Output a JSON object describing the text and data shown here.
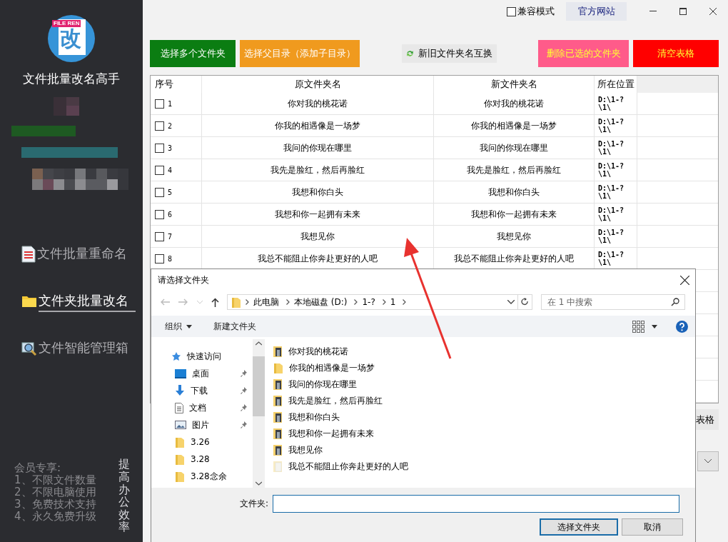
{
  "app": {
    "logo_badge": "FILE REN",
    "logo_char": "改",
    "title": "文件批量改名高手"
  },
  "sidebar": {
    "items": [
      {
        "label": "文件批量重命名",
        "kind": "document",
        "selected": false
      },
      {
        "label": "文件夹批量改名",
        "kind": "folder",
        "selected": true
      },
      {
        "label": "文件智能管理箱",
        "kind": "search",
        "selected": false
      }
    ],
    "promo_lines": [
      "会员专享:",
      "1、不限文件数量",
      "2、不限电脑使用",
      "3、免费技术支持",
      "4、永久免费升级"
    ],
    "slogan": "提高办公效率"
  },
  "titlebar": {
    "compat_mode": {
      "label": "兼容模式",
      "checked": false
    },
    "website": "官方网站"
  },
  "toolbar": [
    {
      "label": "选择多个文件夹",
      "color": "#0b7d12"
    },
    {
      "label": "选择父目录（添加子目录）",
      "color": "#f09a1e"
    },
    {
      "label": "新旧文件夹名互换",
      "color": "#e8e8e8"
    },
    {
      "label": "删除已选的文件夹",
      "color": "#ff5b8a"
    },
    {
      "label": "清空表格",
      "color": "#ff0000"
    }
  ],
  "table": {
    "columns": [
      "序号",
      "原文件夹名",
      "新文件夹名",
      "所在位置"
    ],
    "rows": [
      {
        "checked": false,
        "index": "1",
        "original": "你对我的桃花诺",
        "new": "你对我的桃花诺",
        "location": "D:\\1-?\\1\\"
      },
      {
        "checked": false,
        "index": "2",
        "original": "你我的相遇像是一场梦",
        "new": "你我的相遇像是一场梦",
        "location": "D:\\1-?\\1\\"
      },
      {
        "checked": false,
        "index": "3",
        "original": "我问的你现在哪里",
        "new": "我问的你现在哪里",
        "location": "D:\\1-?\\1\\"
      },
      {
        "checked": false,
        "index": "4",
        "original": "我先是脸红，然后再脸红",
        "new": "我先是脸红，然后再脸红",
        "location": "D:\\1-?\\1\\"
      },
      {
        "checked": false,
        "index": "5",
        "original": "我想和你白头",
        "new": "我想和你白头",
        "location": "D:\\1-?\\1\\"
      },
      {
        "checked": false,
        "index": "6",
        "original": "我想和你一起拥有未来",
        "new": "我想和你一起拥有未来",
        "location": "D:\\1-?\\1\\"
      },
      {
        "checked": false,
        "index": "7",
        "original": "我想见你",
        "new": "我想见你",
        "location": "D:\\1-?\\1\\"
      },
      {
        "checked": false,
        "index": "8",
        "original": "我总不能阻止你奔赴更好的人吧",
        "new": "我总不能阻止你奔赴更好的人吧",
        "location": "D:\\1-?\\1\\"
      }
    ]
  },
  "behind_button": "表格",
  "dialog": {
    "title": "请选择文件夹",
    "path": [
      "此电脑",
      "本地磁盘 (D:)",
      "1-?",
      "1"
    ],
    "search_placeholder": "在 1 中搜索",
    "toolbar": [
      "组织",
      "新建文件夹"
    ],
    "nav": [
      {
        "label": "快速访问",
        "kind": "star",
        "pinned": false
      },
      {
        "label": "桌面",
        "kind": "desktop",
        "pinned": true
      },
      {
        "label": "下载",
        "kind": "download",
        "pinned": true
      },
      {
        "label": "文档",
        "kind": "document",
        "pinned": true
      },
      {
        "label": "图片",
        "kind": "pictures",
        "pinned": true
      },
      {
        "label": "3.26",
        "kind": "folder",
        "pinned": false
      },
      {
        "label": "3.28",
        "kind": "folder",
        "pinned": false
      },
      {
        "label": "3.28念余",
        "kind": "folder",
        "pinned": false
      }
    ],
    "files": [
      {
        "name": "你对我的桃花诺"
      },
      {
        "name": "你我的相遇像是一场梦",
        "kind": "plain"
      },
      {
        "name": "我问的你现在哪里"
      },
      {
        "name": "我先是脸红，然后再脸红"
      },
      {
        "name": "我想和你白头"
      },
      {
        "name": "我想和你一起拥有未来"
      },
      {
        "name": "我想见你"
      },
      {
        "name": "我总不能阻止你奔赴更好的人吧",
        "kind": "blank"
      }
    ],
    "folder_label": "文件夹:",
    "buttons": [
      "选择文件夹",
      "取消"
    ]
  }
}
